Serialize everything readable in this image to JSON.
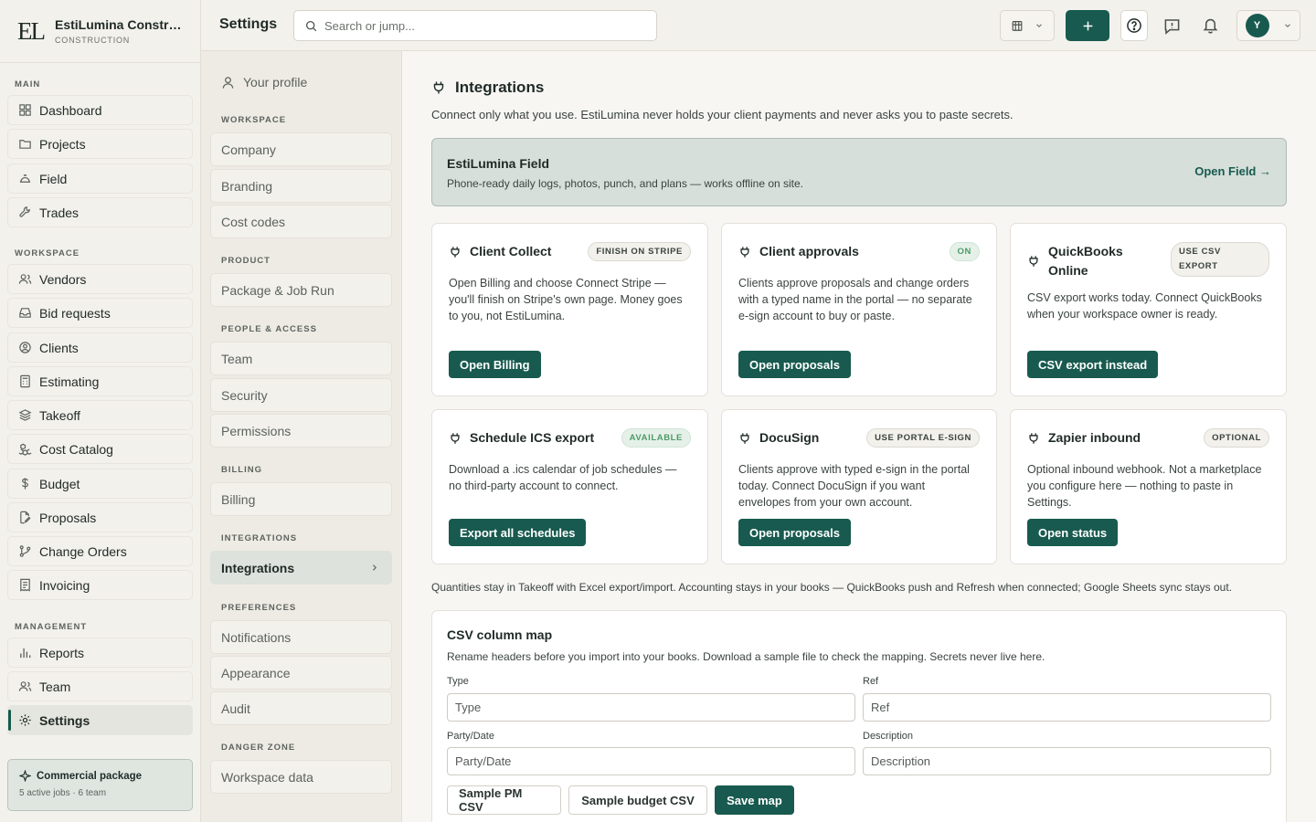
{
  "brand": {
    "logo": "EL",
    "name": "EstiLumina Construction",
    "sub": "CONSTRUCTION"
  },
  "sidebar": {
    "sections": [
      {
        "label": "MAIN",
        "items": [
          {
            "label": "Dashboard",
            "icon": "grid-icon"
          },
          {
            "label": "Projects",
            "icon": "folder-icon"
          },
          {
            "label": "Field",
            "icon": "hardhat-icon"
          },
          {
            "label": "Trades",
            "icon": "wrench-icon"
          }
        ]
      },
      {
        "label": "WORKSPACE",
        "items": [
          {
            "label": "Vendors",
            "icon": "users-icon"
          },
          {
            "label": "Bid requests",
            "icon": "inbox-icon"
          },
          {
            "label": "Clients",
            "icon": "user-circle-icon"
          },
          {
            "label": "Estimating",
            "icon": "calculator-icon"
          },
          {
            "label": "Takeoff",
            "icon": "layers-icon"
          },
          {
            "label": "Cost Catalog",
            "icon": "boxes-icon"
          },
          {
            "label": "Budget",
            "icon": "dollar-icon"
          },
          {
            "label": "Proposals",
            "icon": "file-edit-icon"
          },
          {
            "label": "Change Orders",
            "icon": "git-branch-icon"
          },
          {
            "label": "Invoicing",
            "icon": "receipt-icon"
          }
        ]
      },
      {
        "label": "MANAGEMENT",
        "items": [
          {
            "label": "Reports",
            "icon": "bar-chart-icon"
          },
          {
            "label": "Team",
            "icon": "users-icon"
          },
          {
            "label": "Settings",
            "icon": "gear-icon",
            "active": true
          }
        ]
      }
    ],
    "package": {
      "title": "Commercial package",
      "sub": "5 active jobs · 6 team"
    }
  },
  "topbar": {
    "title": "Settings",
    "search_placeholder": "Search or jump...",
    "avatar": "Y"
  },
  "settings_nav": {
    "profile": "Your profile",
    "groups": [
      {
        "label": "WORKSPACE",
        "items": [
          "Company",
          "Branding",
          "Cost codes"
        ]
      },
      {
        "label": "PRODUCT",
        "items": [
          "Package & Job Run"
        ]
      },
      {
        "label": "PEOPLE & ACCESS",
        "items": [
          "Team",
          "Security",
          "Permissions"
        ]
      },
      {
        "label": "BILLING",
        "items": [
          "Billing"
        ]
      },
      {
        "label": "INTEGRATIONS",
        "items": [
          "Integrations"
        ]
      },
      {
        "label": "PREFERENCES",
        "items": [
          "Notifications",
          "Appearance",
          "Audit"
        ]
      },
      {
        "label": "DANGER ZONE",
        "items": [
          "Workspace data"
        ]
      }
    ],
    "active": "Integrations"
  },
  "integrations": {
    "title": "Integrations",
    "intro": "Connect only what you use. EstiLumina never holds your client payments and never asks you to paste secrets.",
    "field": {
      "title": "EstiLumina Field",
      "desc": "Phone-ready daily logs, photos, punch, and plans — works offline on site.",
      "link": "Open Field →"
    },
    "cards": [
      {
        "title": "Client Collect",
        "badge": "FINISH ON STRIPE",
        "badge_style": "neutral",
        "desc": "Open Billing and choose Connect Stripe — you'll finish on Stripe's own page. Money goes to you, not EstiLumina.",
        "button": "Open Billing"
      },
      {
        "title": "Client approvals",
        "badge": "ON",
        "badge_style": "green",
        "desc": "Clients approve proposals and change orders with a typed name in the portal — no separate e-sign account to buy or paste.",
        "button": "Open proposals"
      },
      {
        "title": "QuickBooks Online",
        "badge": "USE CSV EXPORT",
        "badge_style": "wrap",
        "desc": "CSV export works today. Connect QuickBooks when your workspace owner is ready.",
        "button": "CSV export instead"
      },
      {
        "title": "Schedule ICS export",
        "badge": "AVAILABLE",
        "badge_style": "green",
        "desc": "Download a .ics calendar of job schedules — no third-party account to connect.",
        "button": "Export all schedules"
      },
      {
        "title": "DocuSign",
        "badge": "USE PORTAL E-SIGN",
        "badge_style": "neutral",
        "desc": "Clients approve with typed e-sign in the portal today. Connect DocuSign if you want envelopes from your own account.",
        "button": "Open proposals"
      },
      {
        "title": "Zapier inbound",
        "badge": "OPTIONAL",
        "badge_style": "neutral",
        "desc": "Optional inbound webhook. Not a marketplace you configure here — nothing to paste in Settings.",
        "button": "Open status"
      }
    ],
    "footnote": "Quantities stay in Takeoff with Excel export/import. Accounting stays in your books — QuickBooks push and Refresh when connected; Google Sheets sync stays out."
  },
  "csv_map": {
    "title": "CSV column map",
    "desc": "Rename headers before you import into your books. Download a sample file to check the mapping. Secrets never live here.",
    "fields": [
      {
        "label": "Type",
        "placeholder": "Type"
      },
      {
        "label": "Ref",
        "placeholder": "Ref"
      },
      {
        "label": "Party/Date",
        "placeholder": "Party/Date"
      },
      {
        "label": "Description",
        "placeholder": "Description"
      }
    ],
    "buttons": {
      "sample_pm": "Sample PM CSV",
      "sample_budget": "Sample budget CSV",
      "save": "Save map"
    }
  },
  "colors": {
    "accent": "#185a4f",
    "background": "#f3f1ec",
    "content_bg": "#f7f6f2",
    "banner": "#d6dfda"
  }
}
